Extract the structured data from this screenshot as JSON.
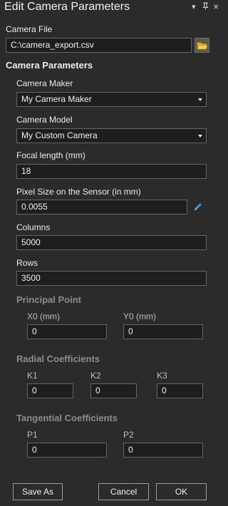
{
  "panel": {
    "title": "Edit Camera Parameters",
    "menu_icon": "▾",
    "pin_icon": "ꟸ",
    "close_icon": "×"
  },
  "camera_file": {
    "label": "Camera File",
    "value": "C:\\camera_export.csv"
  },
  "camera_parameters": {
    "heading": "Camera Parameters",
    "maker": {
      "label": "Camera Maker",
      "value": "My Camera Maker"
    },
    "model": {
      "label": "Camera Model",
      "value": "My Custom Camera"
    },
    "focal_length": {
      "label": "Focal length (mm)",
      "value": "18"
    },
    "pixel_size": {
      "label": "Pixel Size on the Sensor (in mm)",
      "value": "0.0055"
    },
    "columns": {
      "label": "Columns",
      "value": "5000"
    },
    "rows": {
      "label": "Rows",
      "value": "3500"
    }
  },
  "principal_point": {
    "heading": "Principal Point",
    "x0": {
      "label": "X0 (mm)",
      "value": "0"
    },
    "y0": {
      "label": "Y0 (mm)",
      "value": "0"
    }
  },
  "radial": {
    "heading": "Radial Coefficients",
    "k1": {
      "label": "K1",
      "value": "0"
    },
    "k2": {
      "label": "K2",
      "value": "0"
    },
    "k3": {
      "label": "K3",
      "value": "0"
    }
  },
  "tangential": {
    "heading": "Tangential Coefficients",
    "p1": {
      "label": "P1",
      "value": "0"
    },
    "p2": {
      "label": "P2",
      "value": "0"
    }
  },
  "buttons": {
    "save_as": "Save As",
    "cancel": "Cancel",
    "ok": "OK"
  },
  "colors": {
    "background": "#2b2b2b",
    "field_bg": "#1e1e1e",
    "pencil": "#3b8fd6",
    "folder": "#e9b730"
  }
}
